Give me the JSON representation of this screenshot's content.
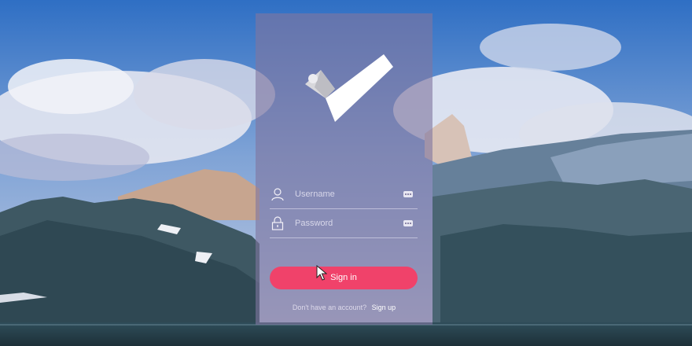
{
  "background": {
    "description_icon": "mountain-landscape-image",
    "sky_color": "#5f8fd0",
    "cloud_color": "#e6e9f3",
    "mountain_color": "#3c5866"
  },
  "logo": {
    "icon": "checkmark-logo-icon"
  },
  "login_form": {
    "username": {
      "icon": "user-icon",
      "placeholder": "Username",
      "value": "",
      "menu_icon": "dots-icon"
    },
    "password": {
      "icon": "lock-icon",
      "placeholder": "Password",
      "value": "",
      "menu_icon": "dots-icon"
    },
    "signin_label": "Sign in",
    "signin_color": "#f0426a"
  },
  "footer": {
    "question": "Don't have an account?",
    "signup_label": "Sign up"
  },
  "cursor": {
    "icon": "mouse-pointer-icon"
  }
}
